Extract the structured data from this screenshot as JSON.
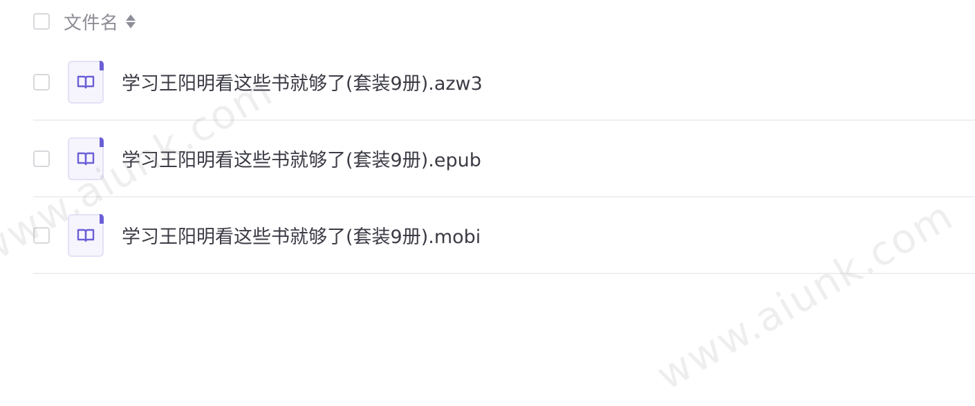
{
  "header": {
    "column_label": "文件名"
  },
  "files": [
    {
      "name": "学习王阳明看这些书就够了(套装9册).azw3"
    },
    {
      "name": "学习王阳明看这些书就够了(套装9册).epub"
    },
    {
      "name": "学习王阳明看这些书就够了(套装9册).mobi"
    }
  ],
  "watermark": {
    "text": "www.aiunk.com"
  },
  "colors": {
    "icon_accent": "#6a5fd6",
    "icon_bg": "#f6f5fd",
    "text": "#3b3b45",
    "header_text": "#8c8c95"
  },
  "icons": {
    "file_type": "book-icon",
    "sort": "sort-icon"
  }
}
